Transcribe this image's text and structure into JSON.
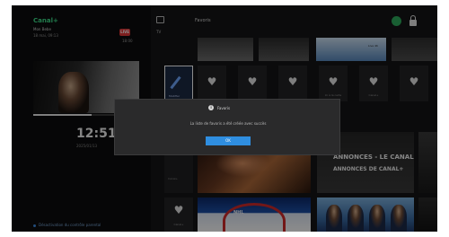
{
  "left_panel": {
    "brand": "Canal+",
    "channel_name": "Mon Bebe",
    "channel_time": "18 mai, 09:13",
    "rec_badge": "LIVE",
    "live_time": "18:00",
    "progress_fraction": 0.55,
    "clock": "12:51",
    "date": "2025/01/13",
    "bottom_note": "Désactivation du contrôle parental"
  },
  "header": {
    "tv_label": "TV",
    "title": "Favoris"
  },
  "top_row": {
    "tile3_label": "Live 4K"
  },
  "favorites_row": {
    "edit_label": "Modifier",
    "tiles": [
      {
        "label": ""
      },
      {
        "label": ""
      },
      {
        "label": ""
      },
      {
        "label": "Ici à la carte"
      },
      {
        "label": "Canal+"
      }
    ]
  },
  "mid_row": {
    "left_tile_label": "Canal+",
    "promo_title_1": "ANNONCES - LE CANAL",
    "promo_title_2": "ANNONCES DE CANAL+"
  },
  "bottom_row": {
    "heart_label": "Canal+",
    "hockey_label": "NHL"
  },
  "dialog": {
    "title": "Favoris",
    "message": "La liste de favoris a été créée avec succès",
    "ok_button": "OK"
  }
}
